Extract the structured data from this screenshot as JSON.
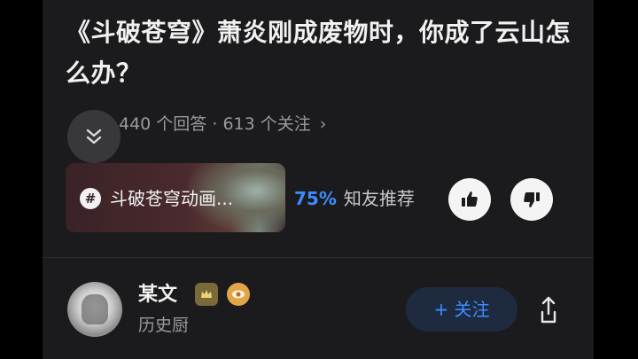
{
  "question": {
    "title": "《斗破苍穹》萧炎刚成废物时，你成了云山怎么办？",
    "answers_count": "440 个回答",
    "separator": " · ",
    "followers_count": "613 个关注",
    "chevron": "›"
  },
  "collapse": {
    "icon": "double-chevron-down-icon"
  },
  "topic": {
    "icon": "hashtag-icon",
    "icon_glyph": "#",
    "label": "斗破苍穹动画..."
  },
  "recommend": {
    "percent": "75%",
    "label": "知友推荐"
  },
  "votes": {
    "up_icon": "thumbs-up-icon",
    "down_icon": "thumbs-down-icon"
  },
  "author": {
    "name": "某文",
    "title": "历史厨",
    "badges": [
      "crown-badge-icon",
      "eye-badge-icon"
    ]
  },
  "actions": {
    "follow_label": "+ 关注",
    "share_icon": "share-icon"
  },
  "colors": {
    "accent": "#3d8cff",
    "background": "#1b1b1d",
    "text_primary": "#f1f1f1",
    "text_secondary": "#9a9a9e"
  }
}
